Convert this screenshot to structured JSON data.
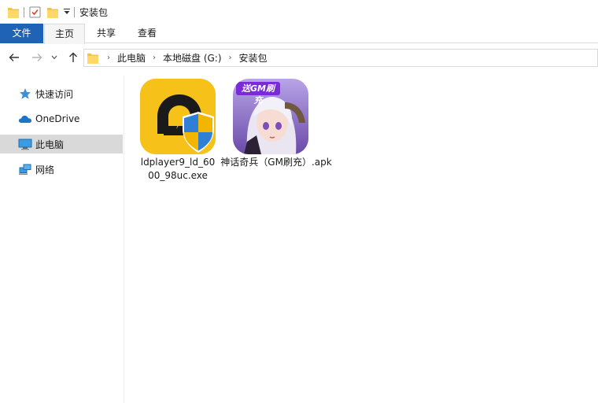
{
  "window": {
    "title": "安装包"
  },
  "ribbon": {
    "tabs": [
      {
        "label": "文件"
      },
      {
        "label": "主页"
      },
      {
        "label": "共享"
      },
      {
        "label": "查看"
      }
    ]
  },
  "address": {
    "crumbs": [
      "此电脑",
      "本地磁盘 (G:)",
      "安装包"
    ]
  },
  "sidebar": {
    "items": [
      {
        "label": "快速访问",
        "icon": "star-icon"
      },
      {
        "label": "OneDrive",
        "icon": "cloud-icon"
      },
      {
        "label": "此电脑",
        "icon": "monitor-icon",
        "selected": true
      },
      {
        "label": "网络",
        "icon": "network-icon"
      }
    ]
  },
  "files": [
    {
      "name_line1": "ldplayer9_ld_60",
      "name_line2": "00_98uc.exe",
      "icon": "ldplayer-icon"
    },
    {
      "name_line1": "神话奇兵（GM刷充）.apk",
      "icon": "game-apk-icon",
      "icon_badge": "送GM刷充"
    }
  ],
  "colors": {
    "accent": "#1e63b6",
    "selected": "#d9d9d9"
  }
}
